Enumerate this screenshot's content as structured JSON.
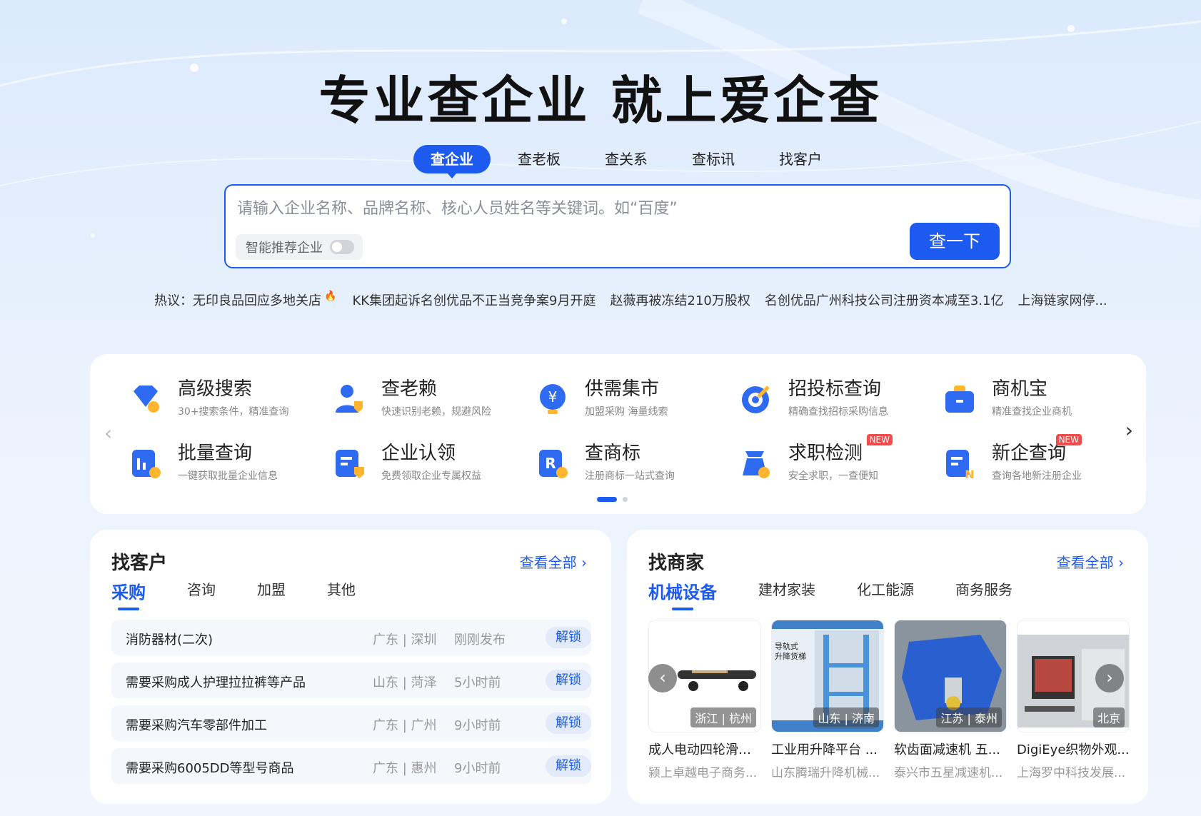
{
  "hero": {
    "title": "专业查企业 就上爱企查"
  },
  "search_tabs": [
    "查企业",
    "查老板",
    "查关系",
    "查标讯",
    "找客户"
  ],
  "search": {
    "placeholder": "请输入企业名称、品牌名称、核心人员姓名等关键词。如“百度”",
    "smart_label": "智能推荐企业",
    "button": "查一下"
  },
  "hot": {
    "prefix": "热议：",
    "items": [
      "无印良品回应多地关店",
      "KK集团起诉名创优品不正当竞争案9月开庭",
      "赵薇再被冻结210万股权",
      "名创优品广州科技公司注册资本减至3.1亿",
      "上海链家网停..."
    ]
  },
  "tools": [
    {
      "name": "高级搜索",
      "desc": "30+搜索条件，精准查询",
      "icon": "diamond-search-icon"
    },
    {
      "name": "查老赖",
      "desc": "快速识别老赖，规避风险",
      "icon": "person-shield-icon"
    },
    {
      "name": "供需集市",
      "desc": "加盟采购 海量线索",
      "icon": "yuan-bulb-icon"
    },
    {
      "name": "招投标查询",
      "desc": "精确查找招标采购信息",
      "icon": "target-icon"
    },
    {
      "name": "商机宝",
      "desc": "精准查找企业商机",
      "icon": "briefcase-icon"
    },
    {
      "name": "批量查询",
      "desc": "一键获取批量企业信息",
      "icon": "batch-search-icon"
    },
    {
      "name": "企业认领",
      "desc": "免费领取企业专属权益",
      "icon": "claim-icon"
    },
    {
      "name": "查商标",
      "desc": "注册商标一站式查询",
      "icon": "trademark-icon"
    },
    {
      "name": "求职检测",
      "desc": "安全求职，一查便知",
      "icon": "job-check-icon",
      "badge": "NEW"
    },
    {
      "name": "新企查询",
      "desc": "查询各地新注册企业",
      "icon": "new-company-icon",
      "badge": "NEW"
    }
  ],
  "customers": {
    "title": "找客户",
    "view_all": "查看全部",
    "tabs": [
      "采购",
      "咨询",
      "加盟",
      "其他"
    ],
    "unlock": "解锁",
    "rows": [
      {
        "title": "消防器材(二次)",
        "loc": "广东 | 深圳",
        "time": "刚刚发布"
      },
      {
        "title": "需要采购成人护理拉拉裤等产品",
        "loc": "山东 | 菏泽",
        "time": "5小时前"
      },
      {
        "title": "需要采购汽车零部件加工",
        "loc": "广东 | 广州",
        "time": "9小时前"
      },
      {
        "title": "需要采购6005DD等型号商品",
        "loc": "广东 | 惠州",
        "time": "9小时前"
      }
    ]
  },
  "merchants": {
    "title": "找商家",
    "view_all": "查看全部",
    "tabs": [
      "机械设备",
      "建材家装",
      "化工能源",
      "商务服务"
    ],
    "products": [
      {
        "name": "成人电动四轮滑板...",
        "company": "颍上卓越电子商务...",
        "loc": "浙江 | 杭州"
      },
      {
        "name": "工业用升降平台 ...",
        "company": "山东腾瑞升降机械...",
        "loc": "山东 | 济南",
        "img_text": "导轨式\n升降货梯"
      },
      {
        "name": "软齿面减速机 五...",
        "company": "泰兴市五星减速机...",
        "loc": "江苏 | 泰州"
      },
      {
        "name": "DigiEye织物外观...",
        "company": "上海罗中科技发展...",
        "loc": "北京"
      }
    ]
  },
  "colors": {
    "accent": "#1d5bf0",
    "badge": "#f24b4b"
  }
}
